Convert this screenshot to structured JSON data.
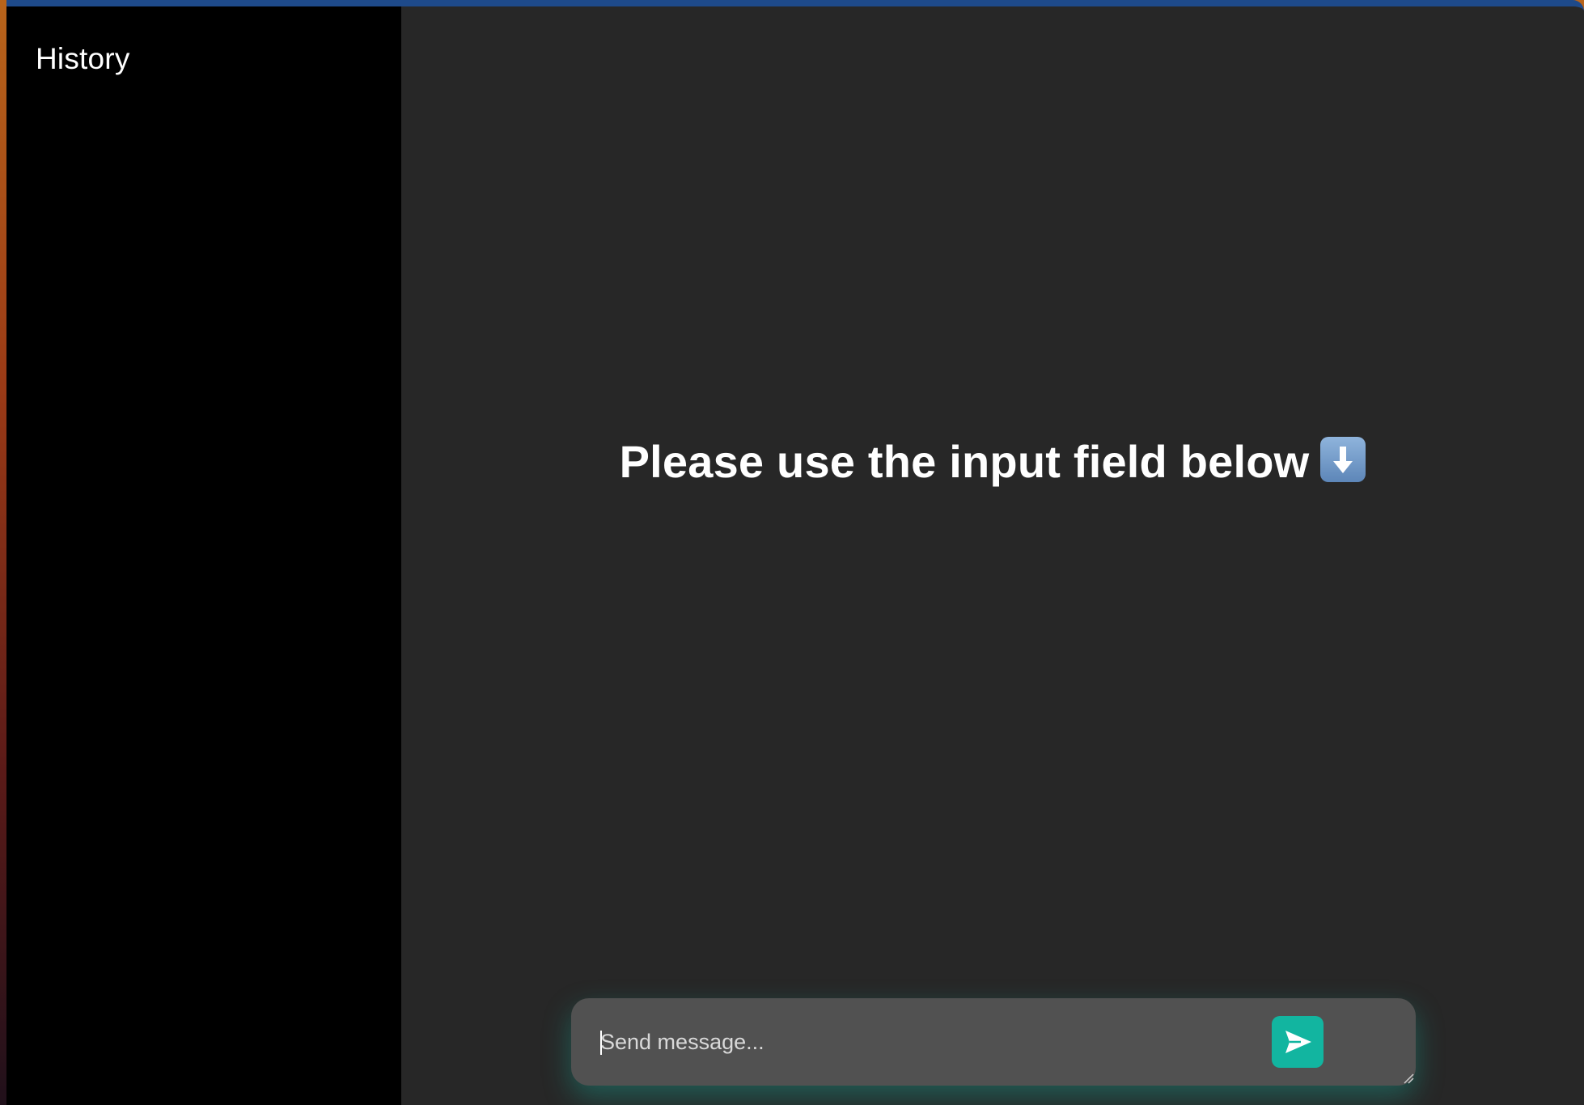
{
  "sidebar": {
    "title": "History"
  },
  "main": {
    "headline": "Please use the input field below",
    "headline_emoji": "down-arrow-emoji-icon"
  },
  "composer": {
    "placeholder": "Send message...",
    "value": "",
    "send_icon": "send-icon"
  },
  "colors": {
    "sidebar_bg": "#000000",
    "main_bg": "#272727",
    "composer_bg": "#515151",
    "accent": "#12b5a0",
    "window_border": "#1e4a8a"
  }
}
